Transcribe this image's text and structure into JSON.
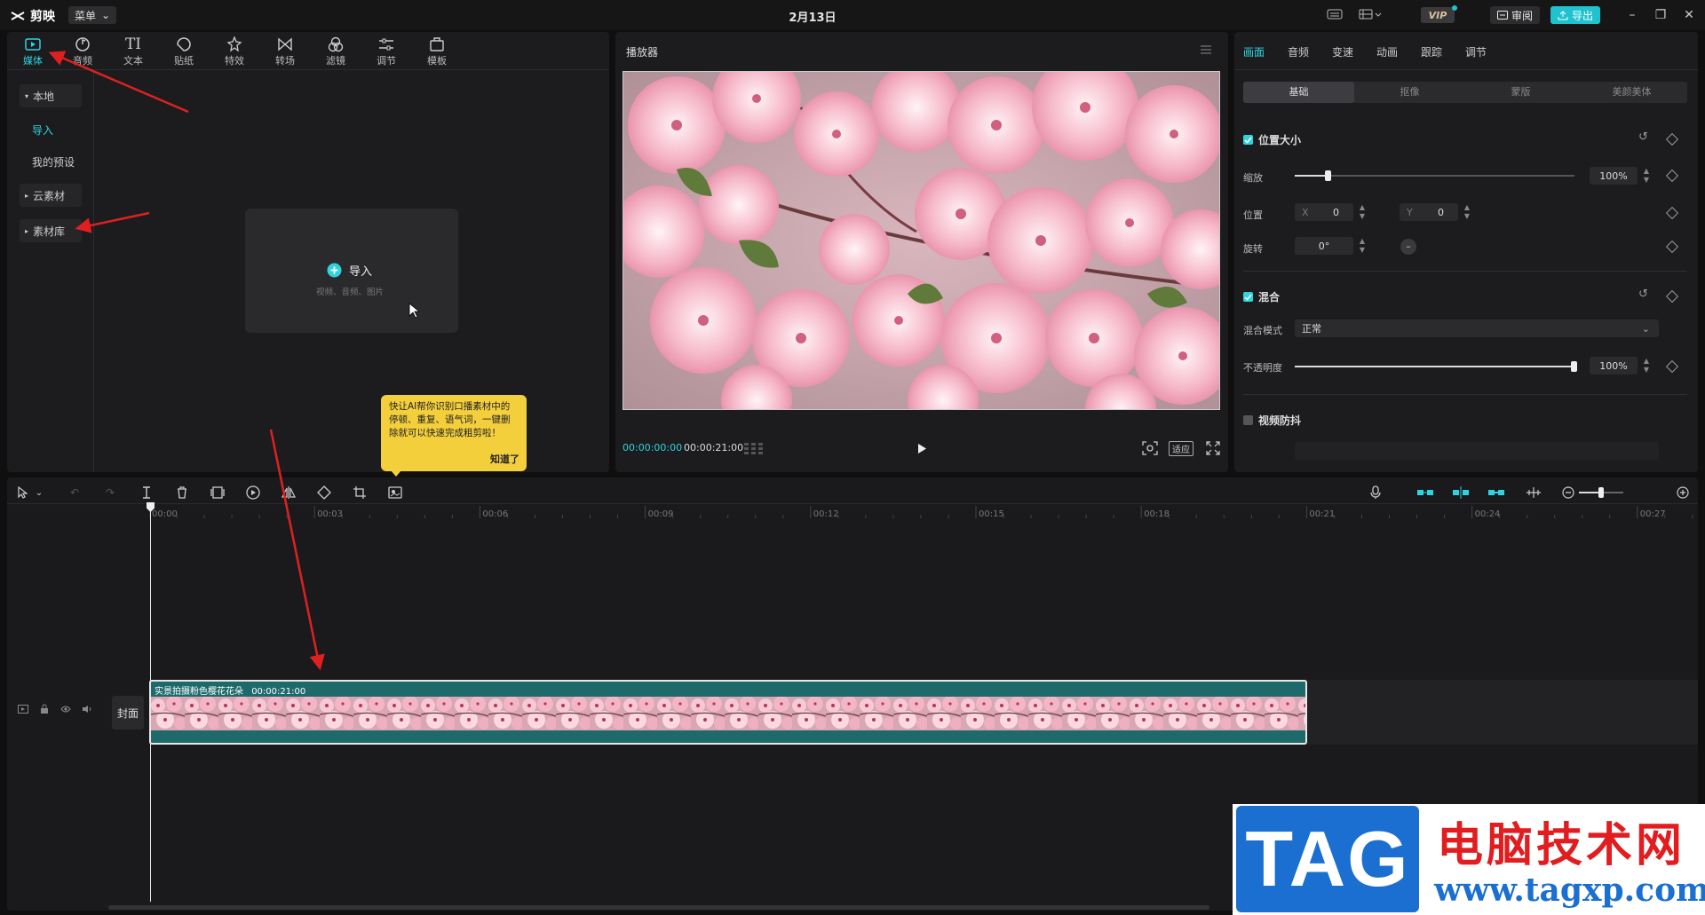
{
  "app": {
    "name": "剪映",
    "menu_label": "菜单",
    "title": "2月13日"
  },
  "topbar": {
    "vip": "VIP",
    "review_label": "审阅",
    "export_label": "导出",
    "accent": "#1fc2cf"
  },
  "media_tabs": [
    {
      "label": "媒体",
      "icon": "media-icon"
    },
    {
      "label": "音频",
      "icon": "audio-icon"
    },
    {
      "label": "文本",
      "icon": "text-icon"
    },
    {
      "label": "贴纸",
      "icon": "sticker-icon"
    },
    {
      "label": "特效",
      "icon": "effects-icon"
    },
    {
      "label": "转场",
      "icon": "transition-icon"
    },
    {
      "label": "滤镜",
      "icon": "filter-icon"
    },
    {
      "label": "调节",
      "icon": "adjust-icon"
    },
    {
      "label": "模板",
      "icon": "template-icon"
    }
  ],
  "media_sidebar": {
    "local": "本地",
    "import": "导入",
    "presets": "我的预设",
    "cloud": "云素材",
    "library": "素材库"
  },
  "import_card": {
    "label": "导入",
    "hint": "视频、音频、图片"
  },
  "tooltip": {
    "text": "快让AI帮你识别口播素材中的停顿、重复、语气词，一键删除就可以快速完成粗剪啦！",
    "ok": "知道了"
  },
  "player": {
    "title": "播放器",
    "current_time": "00:00:00:00",
    "total_time": "00:00:21:00",
    "ratio_label": "适应"
  },
  "right_tabs": [
    "画面",
    "音频",
    "变速",
    "动画",
    "跟踪",
    "调节"
  ],
  "right_subtabs": [
    "基础",
    "抠像",
    "蒙版",
    "美颜美体"
  ],
  "position_size": {
    "title": "位置大小",
    "scale_label": "缩放",
    "scale_value": "100%",
    "scale_level": 0.12,
    "position_label": "位置",
    "x_label": "X",
    "x_value": "0",
    "y_label": "Y",
    "y_value": "0",
    "rotate_label": "旋转",
    "rotate_value": "0°"
  },
  "blend": {
    "title": "混合",
    "mode_label": "混合模式",
    "mode_value": "正常",
    "opacity_label": "不透明度",
    "opacity_value": "100%",
    "opacity_level": 1.0
  },
  "stabilize": {
    "title": "视频防抖"
  },
  "timeline": {
    "ticks": [
      "00:00",
      "00:03",
      "00:06",
      "00:09",
      "00:12",
      "00:15",
      "00:18",
      "00:21",
      "00:24",
      "00:27"
    ],
    "cover_label": "封面",
    "clip_name": "实景拍摄粉色樱花花朵",
    "clip_duration": "00:00:21:00"
  },
  "watermark": {
    "tag": "TAG",
    "cn": "电脑技术网",
    "url": "www.tagxp.com"
  }
}
